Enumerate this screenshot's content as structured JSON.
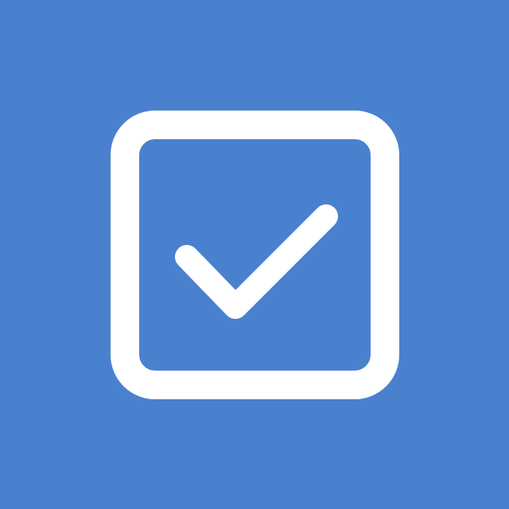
{
  "app_icon": {
    "icon_name": "checkbox-checked-icon",
    "background_color": "#4a81cf",
    "foreground_color": "#ffffff",
    "state": "checked"
  }
}
